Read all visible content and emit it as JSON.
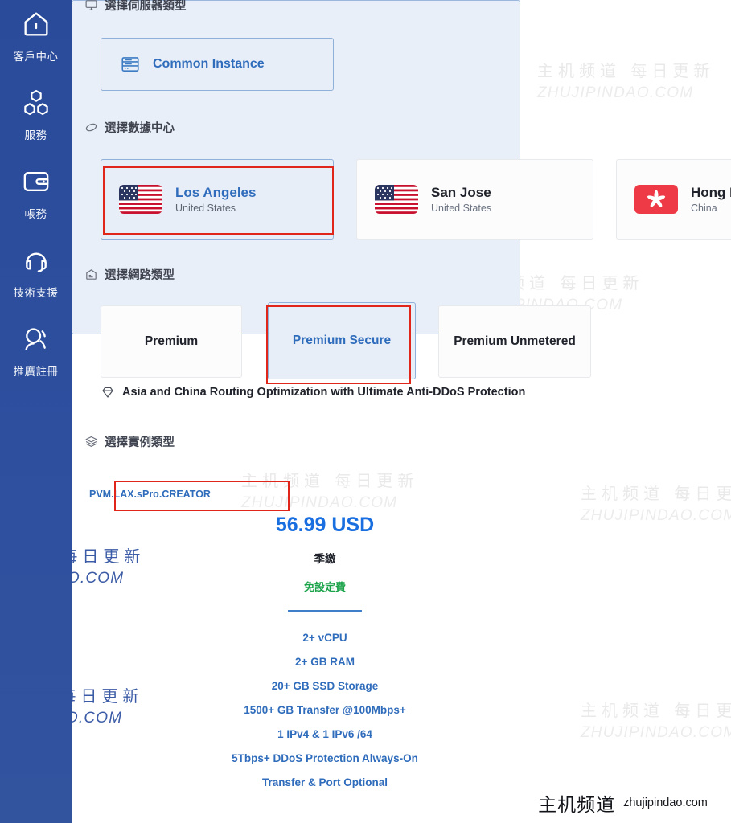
{
  "sidebar": {
    "background_color": "#2a4c9b",
    "items": [
      {
        "icon": "home-icon",
        "label": "客戶中心"
      },
      {
        "icon": "cubes-icon",
        "label": "服務"
      },
      {
        "icon": "wallet-icon",
        "label": "帳務"
      },
      {
        "icon": "headset-icon",
        "label": "技術支援"
      },
      {
        "icon": "affiliate-person-icon",
        "label": "推廣註冊"
      }
    ]
  },
  "sections": {
    "server_type": {
      "icon": "monitor-icon",
      "title": "選擇伺服器類型",
      "options": [
        {
          "icon": "server-rack-icon",
          "label": "Common Instance",
          "selected": true
        }
      ]
    },
    "datacenter": {
      "icon": "globe-icon",
      "title": "選擇數據中心",
      "options": [
        {
          "flag": "us-flag-icon",
          "city": "Los Angeles",
          "country": "United States",
          "selected": true
        },
        {
          "flag": "us-flag-icon",
          "city": "San Jose",
          "country": "United States",
          "selected": false
        },
        {
          "flag": "hk-flag-icon",
          "city": "Hong Kong",
          "country": "China",
          "selected": false
        }
      ]
    },
    "network_type": {
      "icon": "network-icon",
      "title": "選擇網路類型",
      "options": [
        {
          "label": "Premium",
          "selected": false
        },
        {
          "label": "Premium Secure",
          "selected": true
        },
        {
          "label": "Premium Unmetered",
          "selected": false
        }
      ],
      "note_icon": "gem-icon",
      "note": "Asia and China Routing Optimization with Ultimate Anti-DDoS Protection"
    },
    "instance_type": {
      "icon": "layers-icon",
      "title": "選擇實例類型",
      "plan": {
        "name": "PVM.LAX.sPro.CREATOR",
        "price": "56.99 USD",
        "billing_cycle": "季繳",
        "setup_fee": "免設定費",
        "specs": [
          "2+ vCPU",
          "2+ GB RAM",
          "20+ GB SSD Storage",
          "1500+ GB Transfer @100Mbps+",
          "1 IPv4 & 1 IPv6 /64",
          "5Tbps+ DDoS Protection Always-On",
          "Transfer & Port Optional"
        ],
        "selected": true
      }
    }
  },
  "annotations": {
    "highlight_color": "#e0251b",
    "boxes": [
      {
        "target": "datacenter-los-angeles"
      },
      {
        "target": "network-premium-secure"
      },
      {
        "target": "plan-name-pvm-lax-spro-creator"
      }
    ]
  },
  "watermark": {
    "cn": "主机频道 每日更新",
    "en": "ZHUJIPINDAO.COM"
  },
  "badge": {
    "cn": "主机频道",
    "domain": "zhujipindao.com"
  }
}
